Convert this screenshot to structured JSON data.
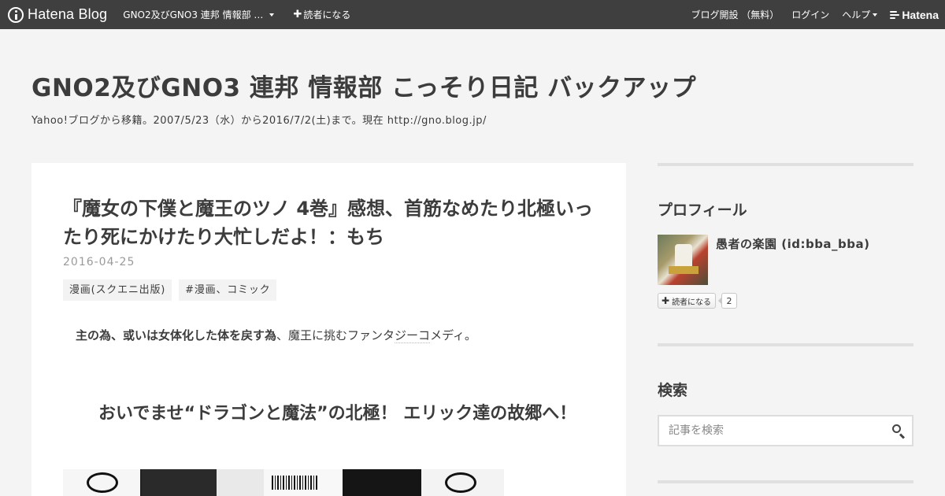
{
  "topbar": {
    "brand": "Hatena Blog",
    "blog_switch_label": "GNO2及びGNO3 連邦 情報部 …",
    "subscribe_label": "読者になる",
    "nav_start_blog": "ブログ開設 （無料）",
    "nav_login": "ログイン",
    "nav_help": "ヘルプ",
    "hatena_logo": "Hatena"
  },
  "header": {
    "title": "GNO2及びGNO3 連邦 情報部 こっそり日記 バックアップ",
    "description": "Yahoo!ブログから移籍。2007/5/23（水）から2016/7/2(土)まで。現在 http://gno.blog.jp/"
  },
  "entry": {
    "title": "『魔女の下僕と魔王のツノ 4巻』感想、首筋なめたり北極いったり死にかけたり大忙しだよ！：もち",
    "date": "2016-04-25",
    "categories": [
      "漫画(スクエニ出版)",
      "#漫画、コミック"
    ],
    "lead_bold": "主の為、或いは女体化した体を戻す為",
    "lead_sep": "、",
    "lead_rest_1": "魔王に挑むファンタ",
    "lead_link": "ジーコ",
    "lead_rest_2": "メディ。",
    "heading": "おいでませ“ドラゴンと魔法”の北極！ エリック達の故郷へ！"
  },
  "sidebar": {
    "profile_heading": "プロフィール",
    "profile_name": "愚者の楽園 (id:bba_bba)",
    "subscribe_label": "読者になる",
    "subscriber_count": "2",
    "search_heading": "検索",
    "search_placeholder": "記事を検索"
  },
  "colors": {
    "topbar_bg": "#3f3f3f",
    "page_bg": "#f4f4f4",
    "text": "#3c3c3c",
    "date": "#9a9a9a"
  },
  "icons": {
    "logo": "hatena-blog-icon",
    "plus": "plus-icon",
    "caret": "caret-down-icon",
    "search": "search-icon"
  }
}
